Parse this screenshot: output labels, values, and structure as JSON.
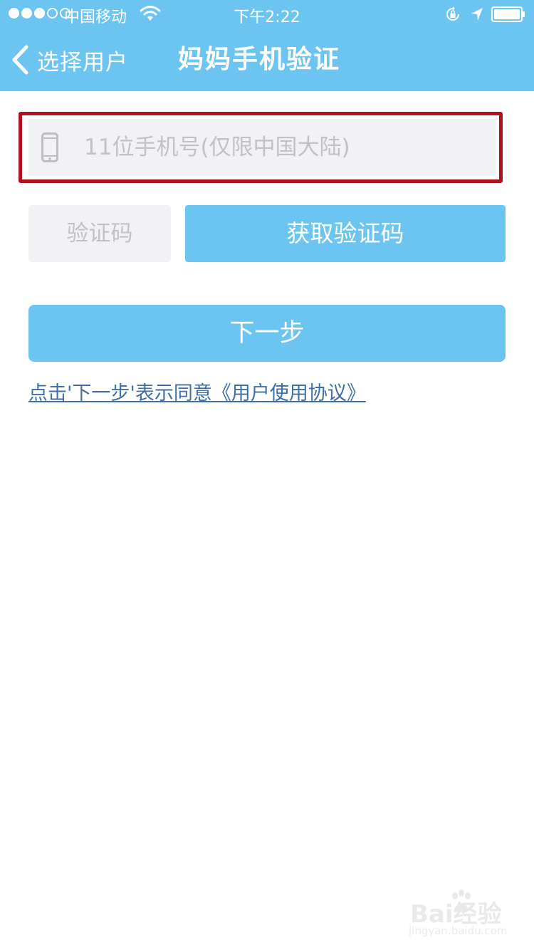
{
  "status_bar": {
    "carrier": "中国移动",
    "time": "下午2:22"
  },
  "nav": {
    "back_label": "选择用户",
    "title": "妈妈手机验证"
  },
  "form": {
    "phone_placeholder": "11位手机号(仅限中国大陆)",
    "code_placeholder": "验证码",
    "get_code_label": "获取验证码",
    "next_label": "下一步",
    "agreement_text": "点击'下一步'表示同意《用户使用协议》"
  },
  "watermark": {
    "main": "Bai经验",
    "sub": "jingyan.baidu.com"
  },
  "colors": {
    "primary": "#6cc5f0",
    "highlight_border": "#b0121d",
    "link": "#3f6ea8",
    "field_bg": "#f2f1f4"
  },
  "icons": [
    "signal-dots-icon",
    "wifi-icon",
    "rotation-lock-icon",
    "location-arrow-icon",
    "battery-icon",
    "back-chevron-icon",
    "mobile-phone-icon",
    "baidu-paw-icon"
  ]
}
